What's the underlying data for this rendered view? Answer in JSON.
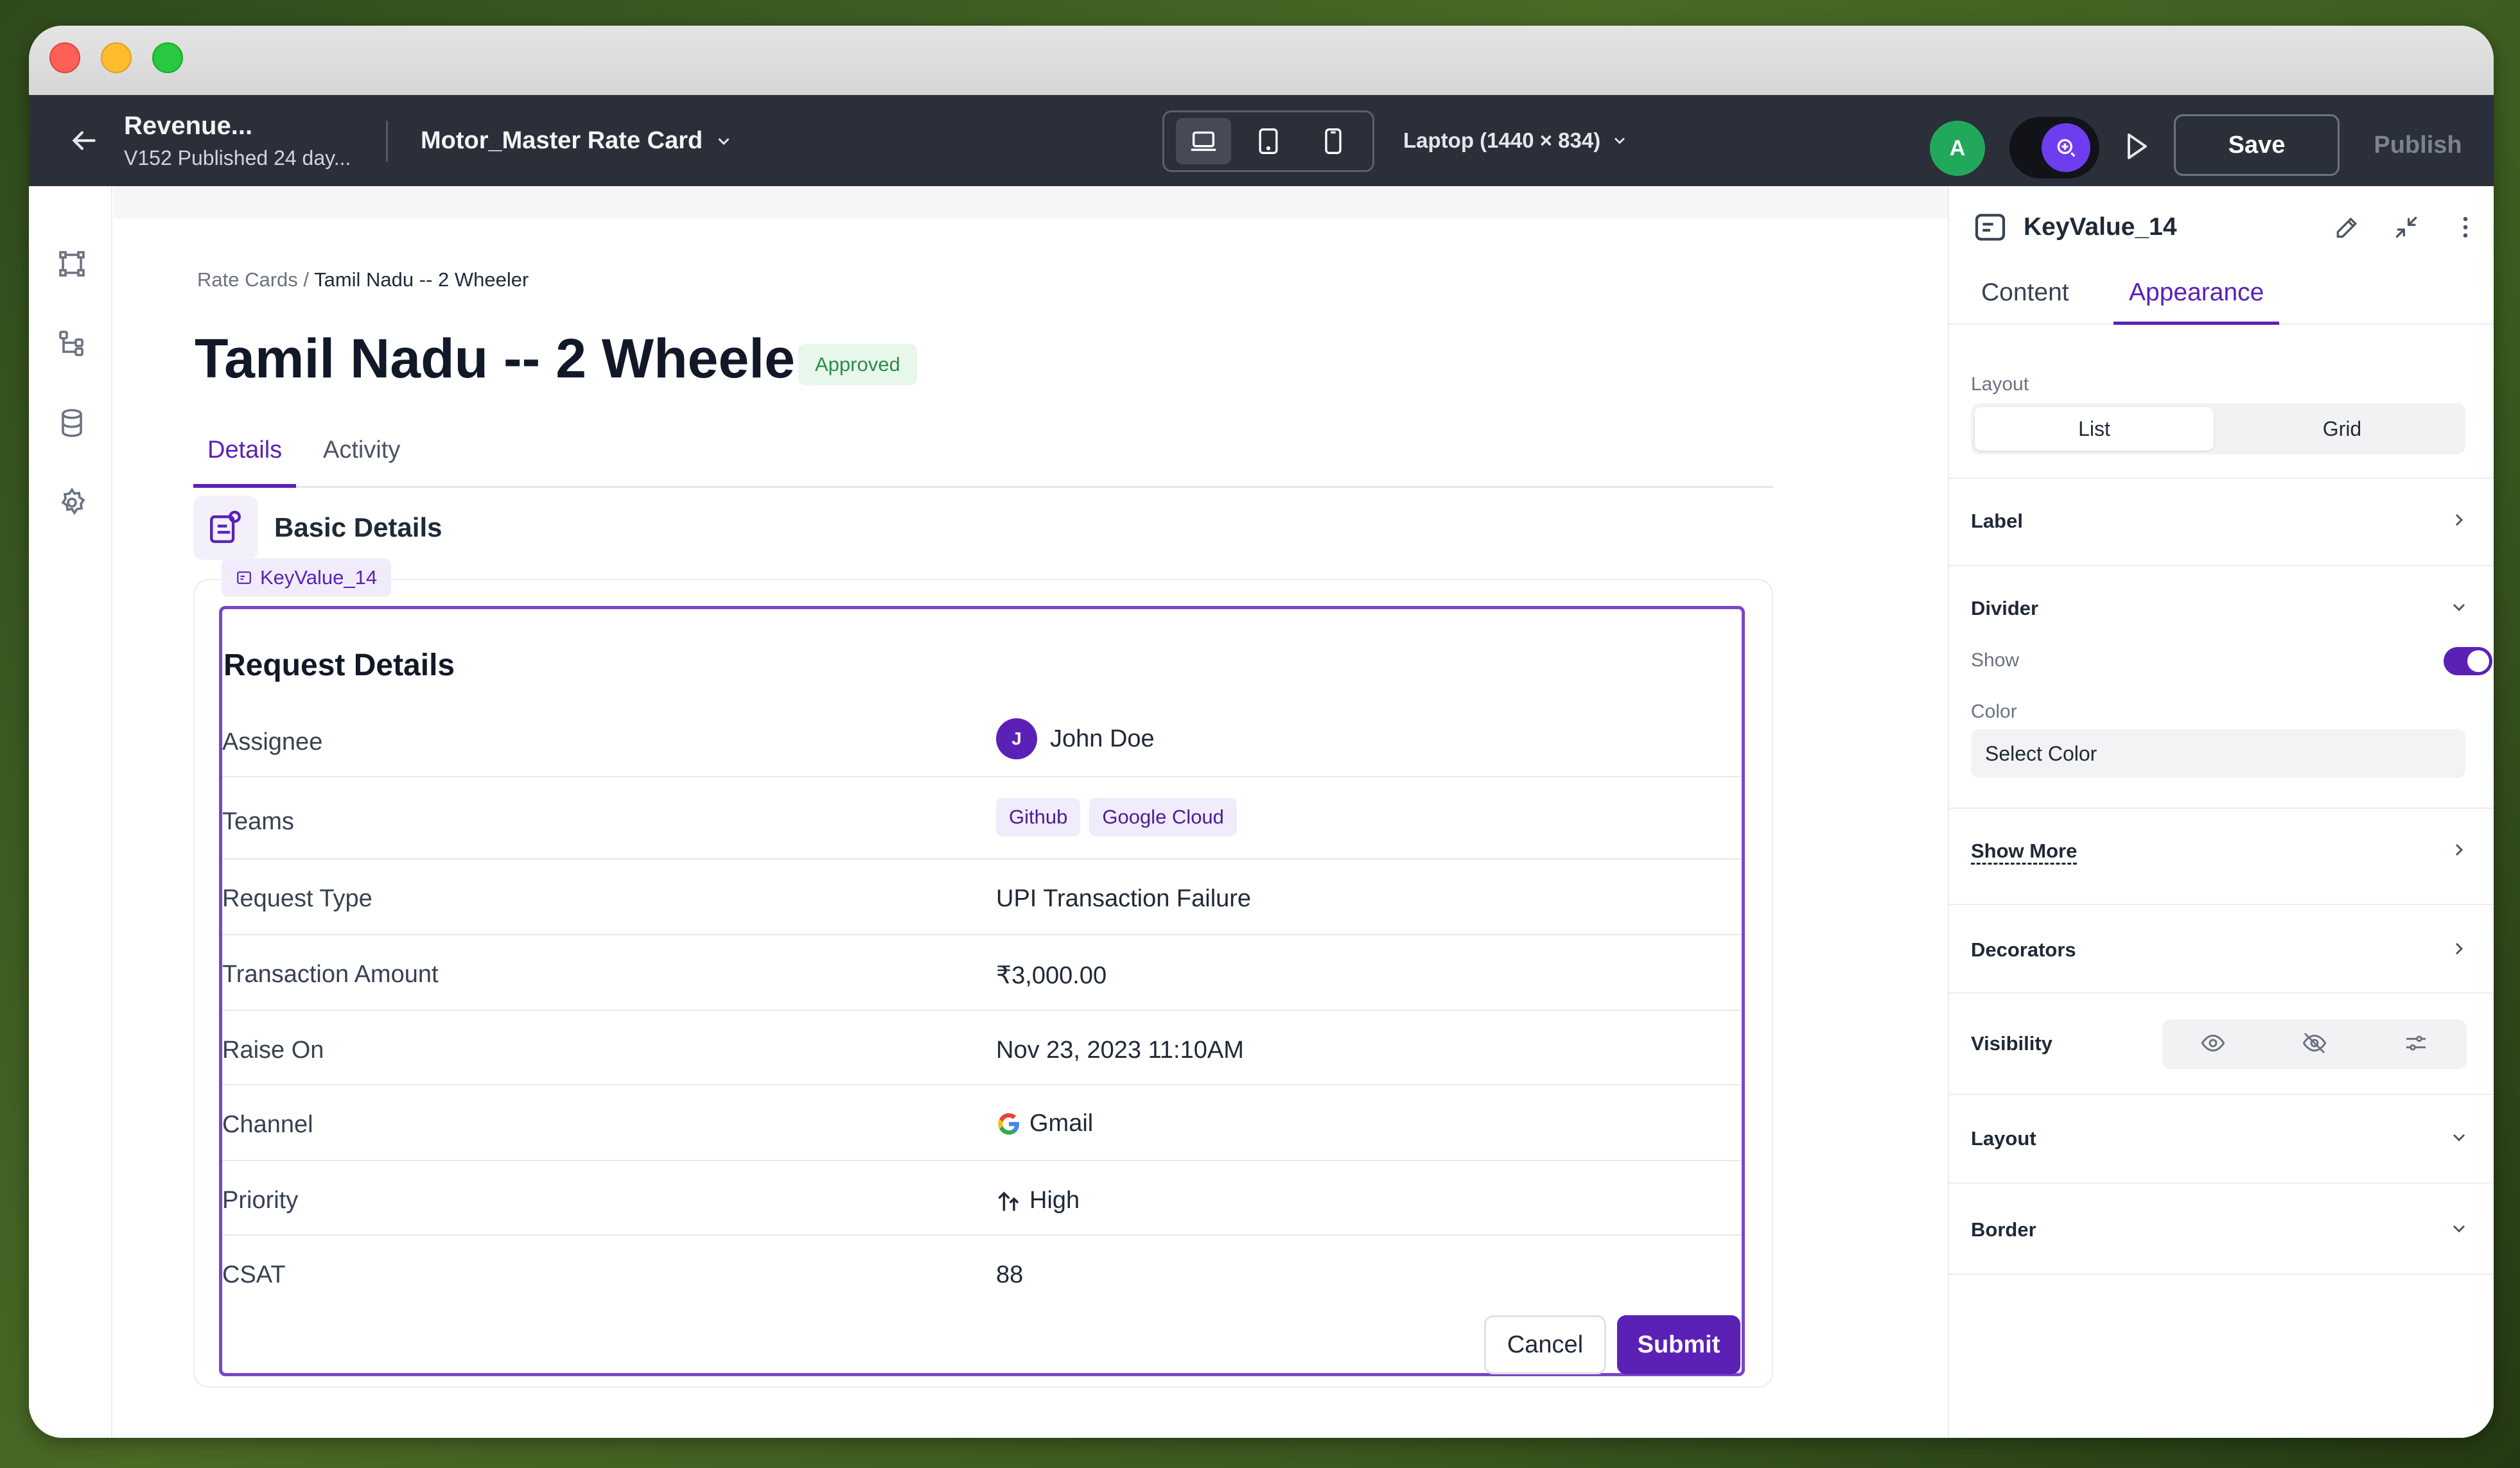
{
  "header": {
    "project_title": "Revenue...",
    "project_subtitle": "V152 Published 24 day...",
    "rate_card": "Motor_Master Rate Card",
    "viewport": "Laptop (1440 × 834)",
    "avatar_initial": "A",
    "save_label": "Save",
    "publish_label": "Publish"
  },
  "sidebar": {
    "icons": [
      "frame-icon",
      "tree-icon",
      "database-icon",
      "settings-icon"
    ]
  },
  "page": {
    "breadcrumb_root": "Rate Cards /",
    "breadcrumb_current": "Tamil Nadu -- 2 Wheeler",
    "title": "Tamil Nadu -- 2 Wheeler",
    "status_badge": "Approved",
    "tabs": [
      "Details",
      "Activity"
    ],
    "section_title": "Basic Details",
    "component_tag": "KeyValue_14"
  },
  "request": {
    "title": "Request Details",
    "rows": [
      {
        "label": "Assignee",
        "value": "John Doe",
        "avatar": "J"
      },
      {
        "label": "Teams",
        "chips": [
          "Github",
          "Google Cloud"
        ]
      },
      {
        "label": "Request Type",
        "value": "UPI Transaction Failure"
      },
      {
        "label": "Transaction Amount",
        "value": "₹3,000.00"
      },
      {
        "label": "Raise On",
        "value": "Nov 23, 2023 11:10AM"
      },
      {
        "label": "Channel",
        "value": "Gmail"
      },
      {
        "label": "Priority",
        "value": "High"
      },
      {
        "label": "CSAT",
        "value": "88"
      }
    ],
    "cancel_label": "Cancel",
    "submit_label": "Submit"
  },
  "panel": {
    "component_name": "KeyValue_14",
    "tabs": [
      "Content",
      "Appearance"
    ],
    "layout_label": "Layout",
    "layout_options": [
      "List",
      "Grid"
    ],
    "label_section": "Label",
    "divider_section": "Divider",
    "show_label": "Show",
    "show_enabled": true,
    "color_label": "Color",
    "color_placeholder": "Select Color",
    "show_more": "Show More",
    "decorators": "Decorators",
    "visibility": "Visibility",
    "layout_section": "Layout",
    "border_section": "Border"
  },
  "colors": {
    "accent": "#5b21b6",
    "appbar": "#2b2f3a",
    "approved_bg": "#e8f7ec",
    "approved_text": "#2f8a4a"
  }
}
